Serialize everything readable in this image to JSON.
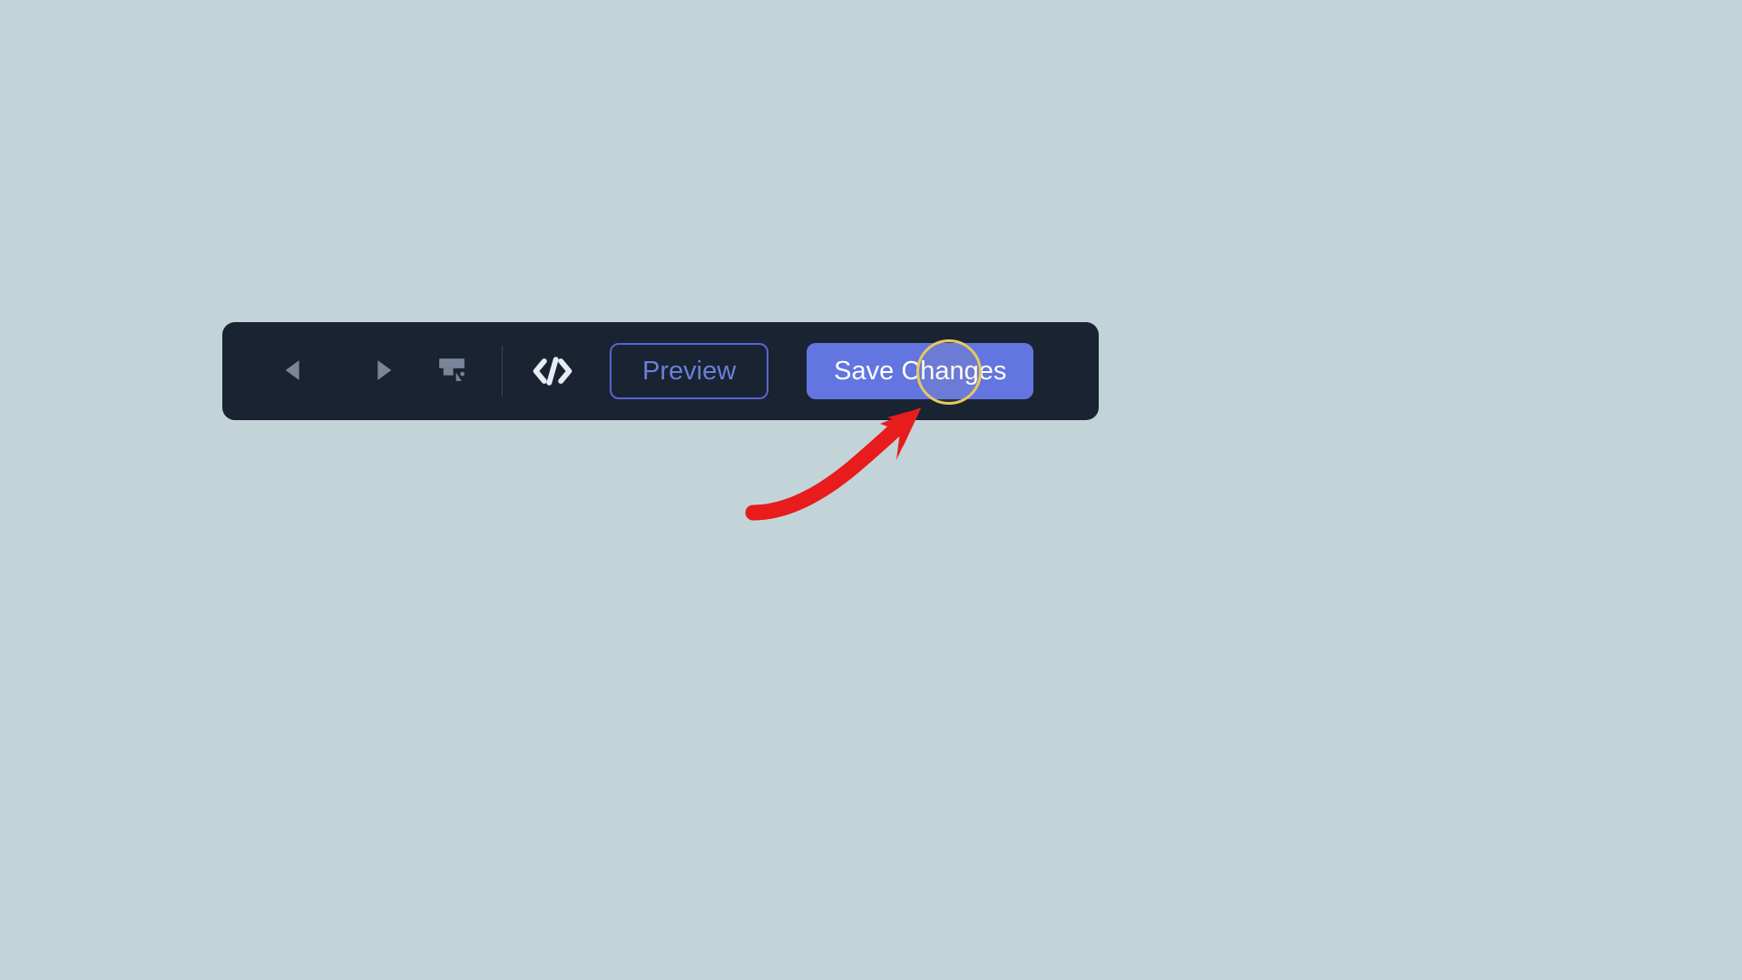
{
  "toolbar": {
    "preview_label": "Preview",
    "save_label": "Save Changes",
    "icons": {
      "undo": "undo-icon",
      "redo": "redo-icon",
      "format_painter": "format-painter-icon",
      "code": "code-icon"
    }
  },
  "annotation": {
    "highlight_target": "save-changes-button",
    "arrow_color": "#e81c1c",
    "circle_color": "#e6c860"
  }
}
